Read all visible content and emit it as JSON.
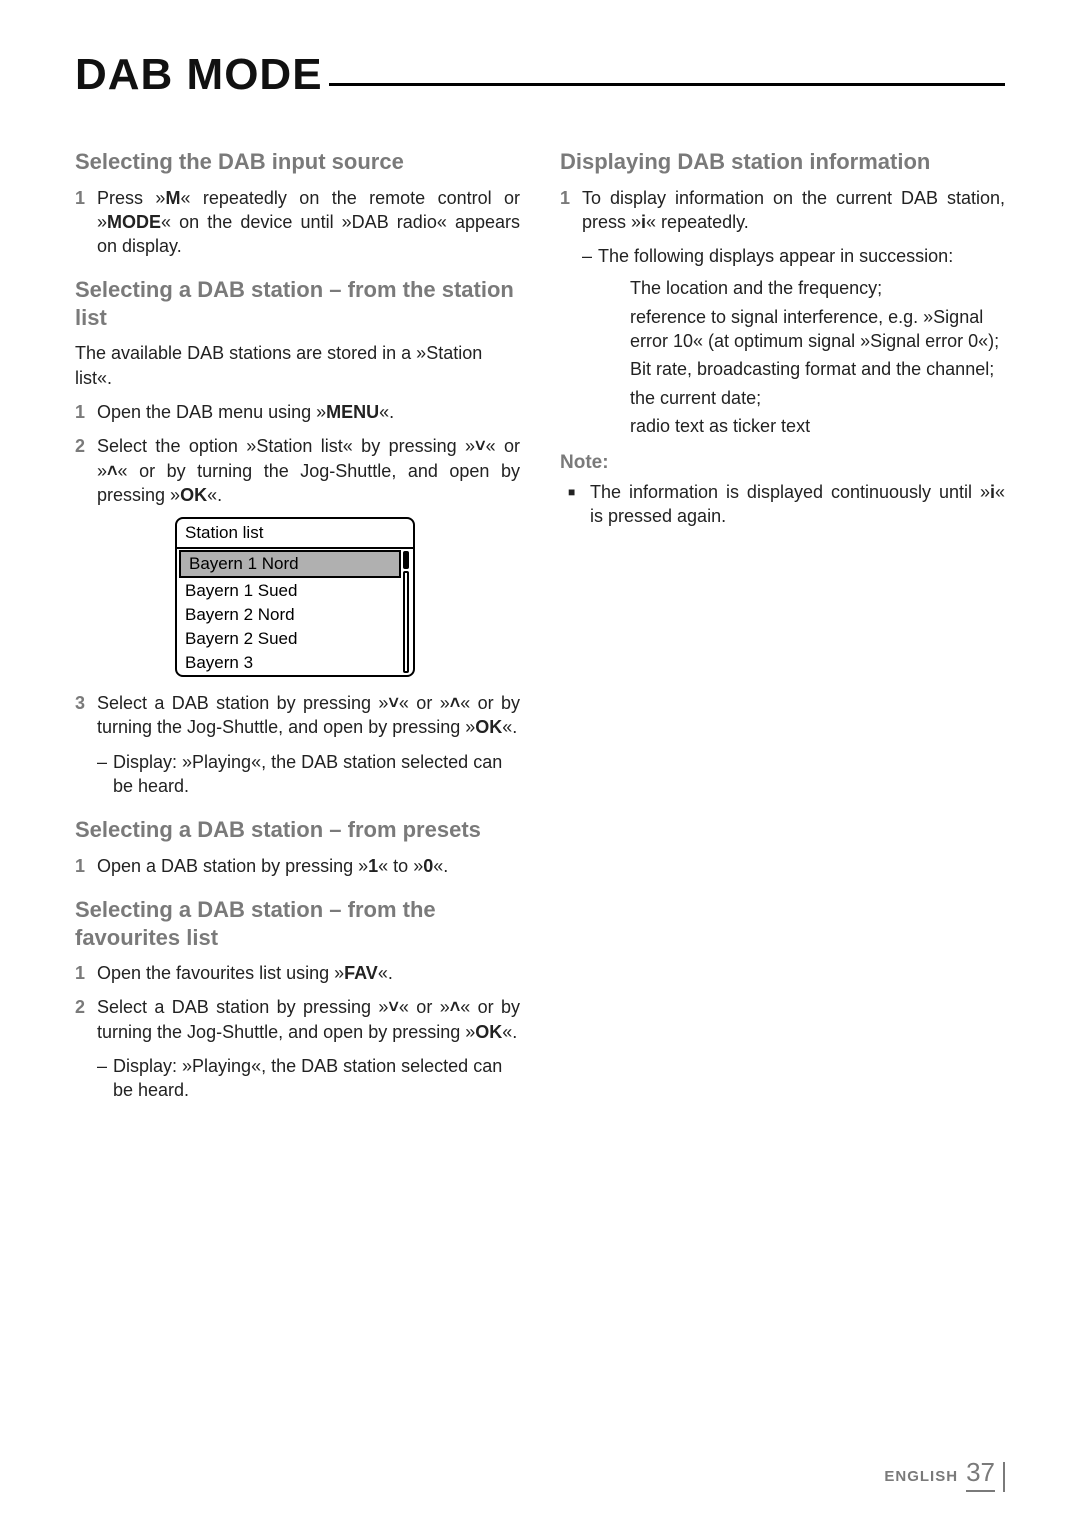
{
  "title": "DAB MODE",
  "glyphs": {
    "down": "˅",
    "up": "˄",
    "info": "i",
    "square": "■"
  },
  "left": {
    "sec1": {
      "heading": "Selecting the DAB input source",
      "step1_num": "1",
      "step1_a": "Press »",
      "step1_m": "M",
      "step1_b": "« repeatedly on the remote control or »",
      "step1_mode": "MODE",
      "step1_c": "« on the device until »DAB radio« appears on display."
    },
    "sec2": {
      "heading": "Selecting a DAB station – from the station list",
      "intro": "The available DAB stations are stored in a »Station list«.",
      "step1_num": "1",
      "step1_a": "Open the DAB menu using »",
      "step1_menu": "MENU",
      "step1_b": "«.",
      "step2_num": "2",
      "step2_a": "Select the option »Station list« by pressing »",
      "step2_b": "« or »",
      "step2_c": "« or by turning the Jog-Shuttle, and open by pressing »",
      "step2_ok": "OK",
      "step2_d": "«.",
      "listbox": {
        "title": "Station list",
        "items": [
          "Bayern 1 Nord",
          "Bayern 1 Sued",
          "Bayern 2 Nord",
          "Bayern 2 Sued",
          "Bayern 3"
        ],
        "selected": 0
      },
      "step3_num": "3",
      "step3_a": "Select a DAB station by pressing »",
      "step3_b": "« or »",
      "step3_c": "« or by turning the Jog-Shuttle, and open by pressing »",
      "step3_ok": "OK",
      "step3_d": "«.",
      "step3_sub": "Display: »Playing«, the DAB station selected can be heard."
    },
    "sec3": {
      "heading": "Selecting a DAB station – from presets",
      "step1_num": "1",
      "step1_a": "Open a DAB station by pressing »",
      "step1_one": "1",
      "step1_b": "« to »",
      "step1_zero": "0",
      "step1_c": "«."
    },
    "sec4": {
      "heading": "Selecting a DAB station – from the favourites list",
      "step1_num": "1",
      "step1_a": "Open the favourites list using »",
      "step1_fav": "FAV",
      "step1_b": "«.",
      "step2_num": "2",
      "step2_a": "Select a DAB station by pressing »",
      "step2_b": "« or »",
      "step2_c": "« or by turning the Jog-Shuttle, and open by pressing »",
      "step2_ok": "OK",
      "step2_d": "«.",
      "step2_sub": "Display: »Playing«, the DAB station selected can be heard."
    }
  },
  "right": {
    "sec1": {
      "heading": "Displaying DAB station information",
      "step1_num": "1",
      "step1_a": "To display information on the current DAB station, press »",
      "step1_b": "« repeatedly.",
      "sub_a": "The following displays appear in succession:",
      "line1": "The location and the frequency;",
      "line2": "reference to signal interference, e.g. »Signal error 10« (at optimum signal »Signal error 0«);",
      "line3": "Bit rate, broadcasting format and the channel;",
      "line4": "the current date;",
      "line5": "radio text as ticker text"
    },
    "note": {
      "heading": "Note:",
      "body_a": "The information is displayed continuously until »",
      "body_b": "« is pressed again."
    }
  },
  "footer": {
    "lang": "ENGLISH",
    "page": "37"
  }
}
